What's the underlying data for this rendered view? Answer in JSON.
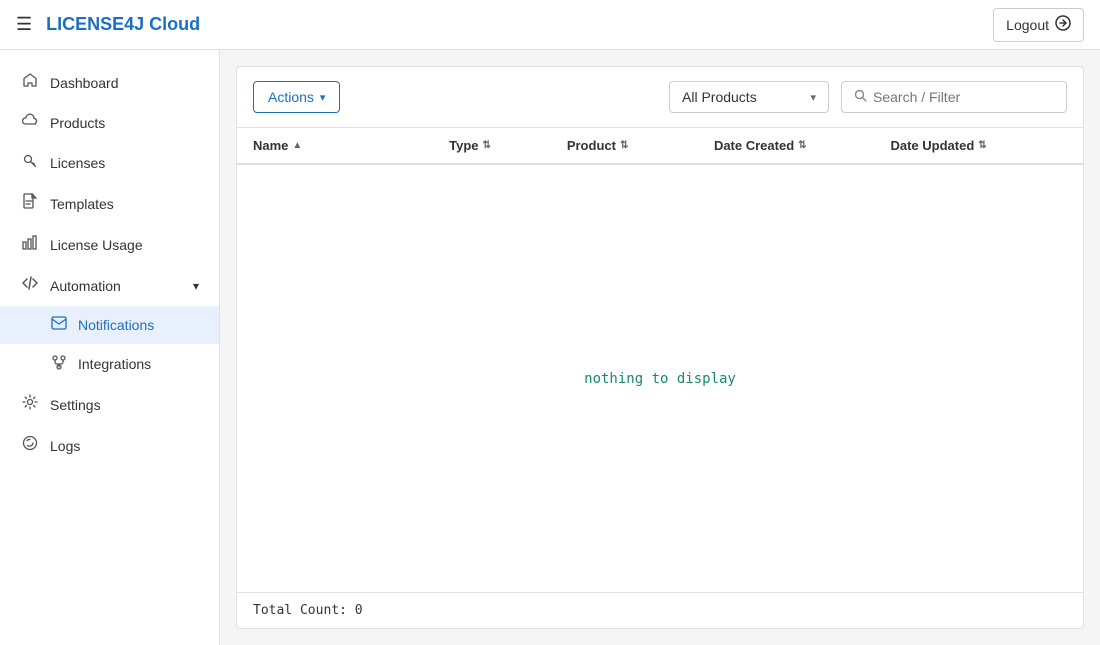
{
  "topnav": {
    "logo": "LICENSE4J Cloud",
    "logout_label": "Logout",
    "hamburger_icon": "☰"
  },
  "sidebar": {
    "items": [
      {
        "id": "dashboard",
        "label": "Dashboard",
        "icon": "house"
      },
      {
        "id": "products",
        "label": "Products",
        "icon": "cloud"
      },
      {
        "id": "licenses",
        "label": "Licenses",
        "icon": "key"
      },
      {
        "id": "templates",
        "label": "Templates",
        "icon": "file"
      },
      {
        "id": "license-usage",
        "label": "License Usage",
        "icon": "chart"
      },
      {
        "id": "automation",
        "label": "Automation",
        "icon": "code",
        "expandable": true,
        "chevron": "▾"
      },
      {
        "id": "notifications",
        "label": "Notifications",
        "icon": "mail",
        "sub": true,
        "active": true
      },
      {
        "id": "integrations",
        "label": "Integrations",
        "icon": "gear-link",
        "sub": true
      },
      {
        "id": "settings",
        "label": "Settings",
        "icon": "gear"
      },
      {
        "id": "logs",
        "label": "Logs",
        "icon": "globe"
      }
    ]
  },
  "toolbar": {
    "actions_label": "Actions",
    "actions_chevron": "▾",
    "product_filter_label": "All Products",
    "product_filter_chevron": "▾",
    "search_placeholder": "Search / Filter",
    "search_icon": "🔍"
  },
  "table": {
    "columns": [
      {
        "id": "name",
        "label": "Name",
        "sort": "▲"
      },
      {
        "id": "type",
        "label": "Type",
        "sort": "⇅"
      },
      {
        "id": "product",
        "label": "Product",
        "sort": "⇅"
      },
      {
        "id": "date_created",
        "label": "Date Created",
        "sort": "⇅"
      },
      {
        "id": "date_updated",
        "label": "Date Updated",
        "sort": "⇅"
      }
    ],
    "empty_message": "nothing to display",
    "total_count_label": "Total Count: 0"
  }
}
